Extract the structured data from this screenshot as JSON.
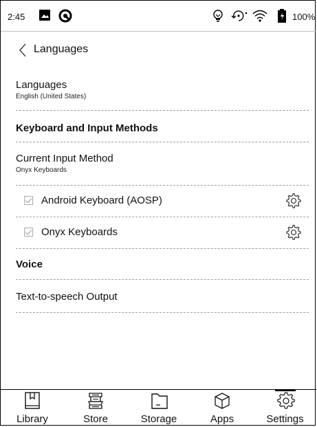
{
  "status_bar": {
    "time": "2:45",
    "battery_percent": "100%",
    "left_icons": [
      "image-icon",
      "sync-status-icon"
    ],
    "right_icons": [
      "lightbulb-icon",
      "rotate-icon",
      "wifi-icon",
      "battery-icon"
    ]
  },
  "header": {
    "back_icon": "chevron-left-icon",
    "title": "Languages"
  },
  "list": {
    "languages": {
      "title": "Languages",
      "subtitle": "English (United States)"
    },
    "keyboard_section": {
      "title": "Keyboard and Input Methods"
    },
    "current_input": {
      "title": "Current Input Method",
      "subtitle": "Onyx Keyboards"
    },
    "keyboards": [
      {
        "label": "Android Keyboard (AOSP)",
        "checked": true,
        "icon": "gear-icon"
      },
      {
        "label": "Onyx Keyboards",
        "checked": true,
        "icon": "gear-icon"
      }
    ],
    "voice_section": {
      "title": "Voice"
    },
    "tts": {
      "title": "Text-to-speech Output"
    }
  },
  "bottom_nav": {
    "items": [
      {
        "label": "Library",
        "icon": "library-icon",
        "active": false
      },
      {
        "label": "Store",
        "icon": "store-icon",
        "active": false
      },
      {
        "label": "Storage",
        "icon": "folder-icon",
        "active": false
      },
      {
        "label": "Apps",
        "icon": "apps-cube-icon",
        "active": false
      },
      {
        "label": "Settings",
        "icon": "settings-gear-icon",
        "active": true
      }
    ]
  },
  "colors": {
    "text": "#111111",
    "divider": "#9e9e9e",
    "background": "#ffffff"
  }
}
